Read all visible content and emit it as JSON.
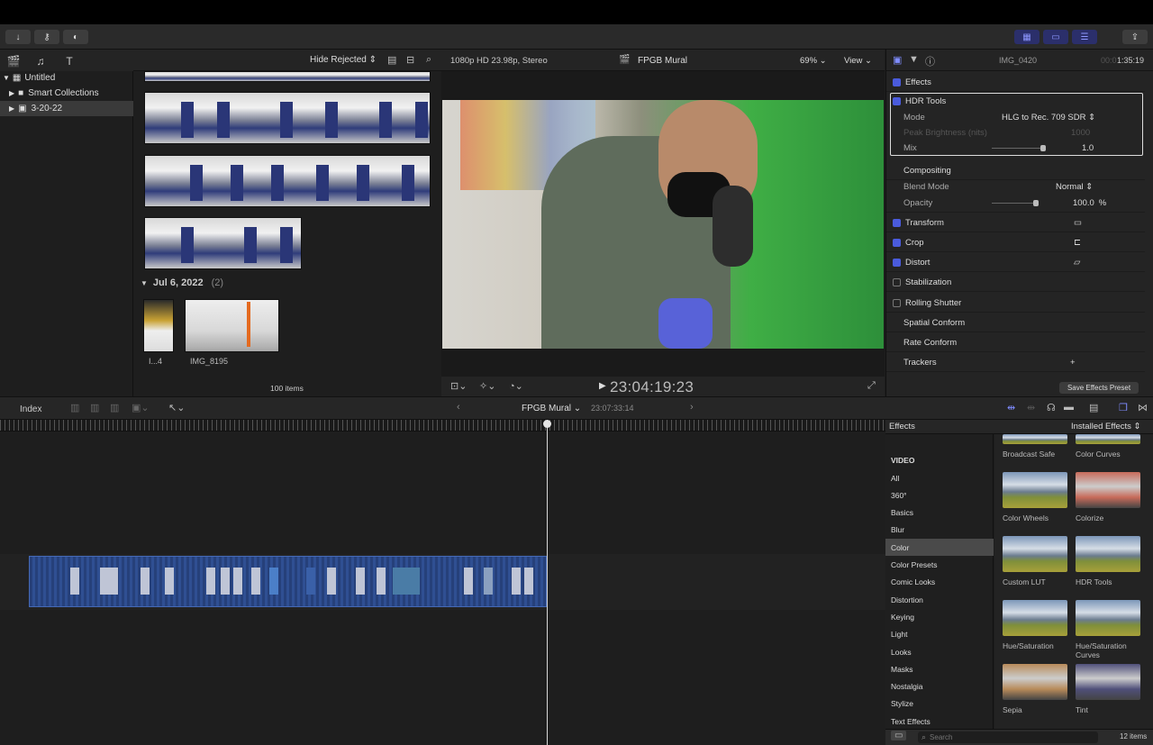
{
  "toolbar": {
    "import_icon": "download-arrow",
    "keywords_icon": "key",
    "bg_tasks_icon": "progress-circle",
    "share_icon": "share"
  },
  "library": {
    "items": [
      {
        "label": "Untitled"
      },
      {
        "label": "Smart Collections"
      },
      {
        "label": "3-20-22"
      }
    ]
  },
  "browser": {
    "filter": "Hide Rejected ⇕",
    "date_group": "Jul 6, 2022",
    "date_count": "(2)",
    "clip1_label": "I...4",
    "clip2_label": "IMG_8195",
    "item_count": "100 items"
  },
  "viewer": {
    "format": "1080p HD 23.98p, Stereo",
    "project": "FPGB Mural",
    "zoom": "69% ⌄",
    "view": "View ⌄",
    "timecode": "23:04:19:23"
  },
  "inspector": {
    "clip_name": "IMG_0420",
    "duration_dim": "00:0",
    "duration": "1:35:19",
    "effects": "Effects",
    "hdr_tools": "HDR Tools",
    "mode_label": "Mode",
    "mode_value": "HLG to Rec. 709 SDR ⇕",
    "peak_label": "Peak Brightness (nits)",
    "peak_value": "1000",
    "mix_label": "Mix",
    "mix_value": "1.0",
    "compositing": "Compositing",
    "blend_label": "Blend Mode",
    "blend_value": "Normal ⇕",
    "opacity_label": "Opacity",
    "opacity_value": "100.0",
    "opacity_unit": "%",
    "transform": "Transform",
    "crop": "Crop",
    "distort": "Distort",
    "stabilization": "Stabilization",
    "rolling_shutter": "Rolling Shutter",
    "spatial_conform": "Spatial Conform",
    "rate_conform": "Rate Conform",
    "trackers": "Trackers",
    "trackers_add": "+",
    "save_preset": "Save Effects Preset"
  },
  "timeline": {
    "index": "Index",
    "project": "FPGB Mural ⌄",
    "duration": "23:07:33:14"
  },
  "effects_browser": {
    "title": "Effects",
    "installed": "Installed Effects ⇕",
    "section": "VIDEO",
    "categories": [
      "All",
      "360°",
      "Basics",
      "Blur",
      "Color",
      "Color Presets",
      "Comic Looks",
      "Distortion",
      "Keying",
      "Light",
      "Looks",
      "Masks",
      "Nostalgia",
      "Stylize",
      "Text Effects"
    ],
    "selected_category": "Color",
    "effects": [
      "Broadcast Safe",
      "Color Curves",
      "Color Wheels",
      "Colorize",
      "Custom LUT",
      "HDR Tools",
      "Hue/Saturation",
      "Hue/Saturation Curves",
      "Sepia",
      "Tint"
    ],
    "search_placeholder": "Search",
    "count": "12 items"
  }
}
